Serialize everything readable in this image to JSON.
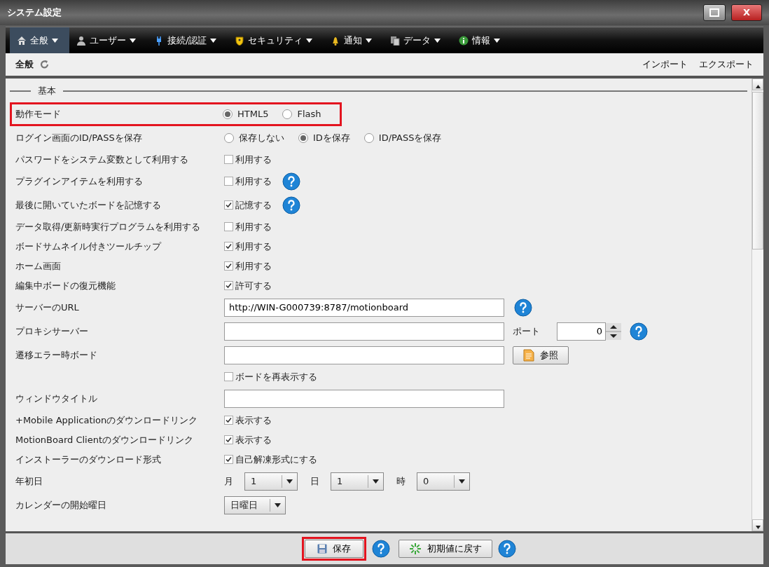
{
  "window": {
    "title": "システム設定",
    "close_label": "X"
  },
  "menu": [
    {
      "label": "全般",
      "selected": true
    },
    {
      "label": "ユーザー",
      "selected": false
    },
    {
      "label": "接続/認証",
      "selected": false
    },
    {
      "label": "セキュリティ",
      "selected": false
    },
    {
      "label": "通知",
      "selected": false
    },
    {
      "label": "データ",
      "selected": false
    },
    {
      "label": "情報",
      "selected": false
    }
  ],
  "toolbar": {
    "title": "全般",
    "links": [
      "インポート",
      "エクスポート"
    ]
  },
  "section": {
    "legend": "基本"
  },
  "rows": [
    {
      "kind": "radio",
      "label": "動作モード",
      "highlighted": true,
      "options": [
        {
          "label": "HTML5",
          "selected": true
        },
        {
          "label": "Flash",
          "selected": false
        }
      ]
    },
    {
      "kind": "radio",
      "label": "ログイン画面のID/PASSを保存",
      "options": [
        {
          "label": "保存しない",
          "selected": false
        },
        {
          "label": "IDを保存",
          "selected": true
        },
        {
          "label": "ID/PASSを保存",
          "selected": false
        }
      ]
    },
    {
      "kind": "checkbox",
      "label": "パスワードをシステム変数として利用する",
      "option": "利用する",
      "checked": false
    },
    {
      "kind": "checkbox",
      "label": "プラグインアイテムを利用する",
      "option": "利用する",
      "checked": false,
      "help": true
    },
    {
      "kind": "checkbox",
      "label": "最後に開いていたボードを記憶する",
      "option": "記憶する",
      "checked": true,
      "help": true
    },
    {
      "kind": "checkbox",
      "label": "データ取得/更新時実行プログラムを利用する",
      "option": "利用する",
      "checked": false
    },
    {
      "kind": "checkbox",
      "label": "ボードサムネイル付きツールチップ",
      "option": "利用する",
      "checked": true
    },
    {
      "kind": "checkbox",
      "label": "ホーム画面",
      "option": "利用する",
      "checked": true
    },
    {
      "kind": "checkbox",
      "label": "編集中ボードの復元機能",
      "option": "許可する",
      "checked": true
    },
    {
      "kind": "text",
      "label": "サーバーのURL",
      "value": "http://WIN-G000739:8787/motionboard",
      "help": true
    },
    {
      "kind": "proxy",
      "label": "プロキシサーバー",
      "value": "",
      "port_label": "ポート",
      "port": "0",
      "help": true
    },
    {
      "kind": "browse",
      "label": "遷移エラー時ボード",
      "value": "",
      "button": "参照"
    },
    {
      "kind": "checkbox",
      "option": "ボードを再表示する",
      "checked": false
    },
    {
      "kind": "text",
      "label": "ウィンドウタイトル",
      "value": ""
    },
    {
      "kind": "checkbox",
      "label": "+Mobile Applicationのダウンロードリンク",
      "option": "表示する",
      "checked": true
    },
    {
      "kind": "checkbox",
      "label": "MotionBoard Clientのダウンロードリンク",
      "option": "表示する",
      "checked": true
    },
    {
      "kind": "checkbox",
      "label": "インストーラーのダウンロード形式",
      "option": "自己解凍形式にする",
      "checked": true
    },
    {
      "kind": "selects",
      "label": "年初日",
      "selects": [
        {
          "prefix": "月",
          "value": "1"
        },
        {
          "prefix": "日",
          "value": "1"
        },
        {
          "prefix": "時",
          "value": "0"
        }
      ]
    },
    {
      "kind": "select",
      "label": "カレンダーの開始曜日",
      "value": "日曜日"
    }
  ],
  "footer": {
    "save": {
      "label": "保存",
      "highlighted": true
    },
    "reset": {
      "label": "初期値に戻す"
    }
  }
}
